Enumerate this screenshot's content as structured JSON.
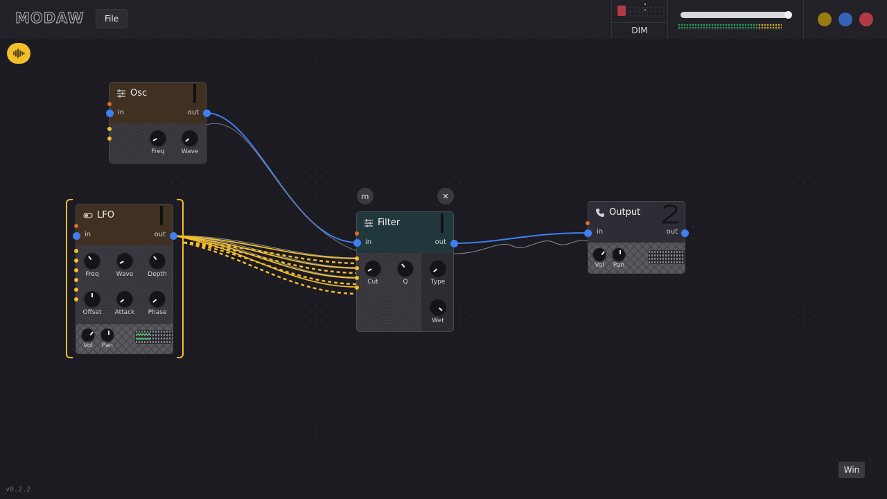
{
  "app": {
    "logo": "MODAW",
    "version": "v0.2.2"
  },
  "menu": {
    "file_label": "File"
  },
  "dim": {
    "label": "DIM"
  },
  "master": {
    "volume_level": 0.97
  },
  "window_controls": {
    "colors": [
      "#9a7a12",
      "#3563b8",
      "#b23a45"
    ]
  },
  "colors": {
    "accent": "#f2be2b",
    "port": "#3f7ff0",
    "cable_blue": "#3f7ff0",
    "cable_yellow": "#f2be2b",
    "osc_head": "#3f3022",
    "lfo_head": "#3f3022",
    "filter_head": "#20383c",
    "output_head": "#2e2d35"
  },
  "nodes": {
    "osc": {
      "title": "Osc",
      "in": "in",
      "out": "out",
      "knobs": [
        {
          "label": "Freq"
        },
        {
          "label": "Wave"
        }
      ]
    },
    "lfo": {
      "title": "LFO",
      "in": "in",
      "out": "out",
      "knobs": [
        {
          "label": "Freq"
        },
        {
          "label": "Wave"
        },
        {
          "label": "Depth"
        },
        {
          "label": "Offset"
        },
        {
          "label": "Attack"
        },
        {
          "label": "Phase"
        }
      ],
      "vol_label": "Vol",
      "pan_label": "Pan"
    },
    "filter": {
      "title": "Filter",
      "in": "in",
      "out": "out",
      "knobs": [
        {
          "label": "Cut"
        },
        {
          "label": "Q"
        },
        {
          "label": "Type"
        },
        {
          "label": "Wet"
        }
      ],
      "m_label": "m",
      "close_label": "✕"
    },
    "output": {
      "title": "Output",
      "in": "in",
      "out": "out",
      "vol_label": "Vol",
      "pan_label": "Pan"
    }
  },
  "win_label": "Win"
}
